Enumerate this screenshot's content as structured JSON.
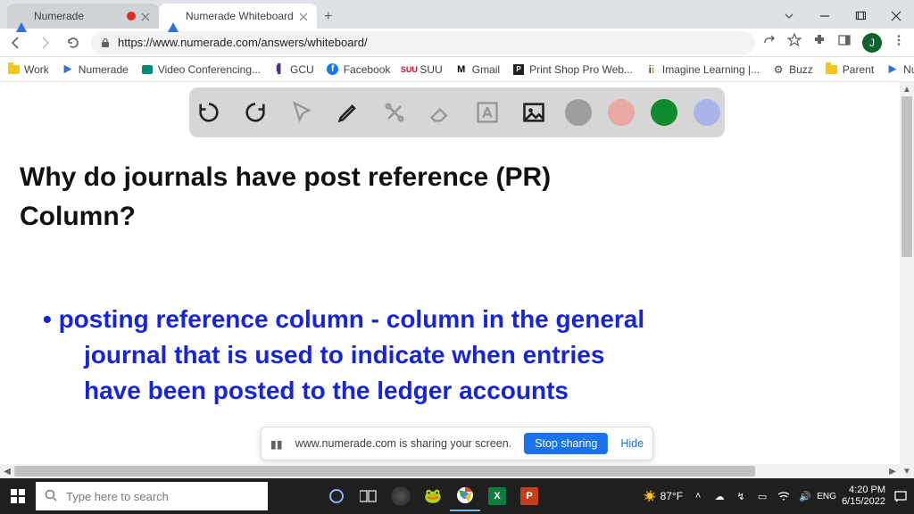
{
  "window": {
    "tabs": [
      {
        "title": "Numerade",
        "recording": true,
        "active": false
      },
      {
        "title": "Numerade Whiteboard",
        "recording": false,
        "active": true
      }
    ]
  },
  "address": {
    "url": "https://www.numerade.com/answers/whiteboard/",
    "avatar_initial": "J"
  },
  "bookmarks": [
    {
      "label": "Work"
    },
    {
      "label": "Numerade"
    },
    {
      "label": "Video Conferencing..."
    },
    {
      "label": "GCU"
    },
    {
      "label": "Facebook"
    },
    {
      "label": "SUU"
    },
    {
      "label": "Gmail"
    },
    {
      "label": "Print Shop Pro Web..."
    },
    {
      "label": "Imagine Learning |..."
    },
    {
      "label": "Buzz"
    },
    {
      "label": "Parent"
    },
    {
      "label": "Numerade Portal"
    }
  ],
  "whiteboard": {
    "colors": {
      "grey": "#9e9e9e",
      "pink": "#e8a9a3",
      "green": "#0f8a2c",
      "blue": "#a9b4e8"
    },
    "handwriting": {
      "question_l1": "Why do journals have post reference (PR)",
      "question_l2": "Column?",
      "answer_l1": "• posting reference column - column in the general",
      "answer_l2": "journal that is used to indicate when entries",
      "answer_l3": "have been posted to the ledger accounts"
    }
  },
  "share": {
    "text": "www.numerade.com is sharing your screen.",
    "stop": "Stop sharing",
    "hide": "Hide"
  },
  "taskbar": {
    "search_placeholder": "Type here to search",
    "weather_temp": "87°F",
    "time": "4:20 PM",
    "date": "6/15/2022"
  }
}
